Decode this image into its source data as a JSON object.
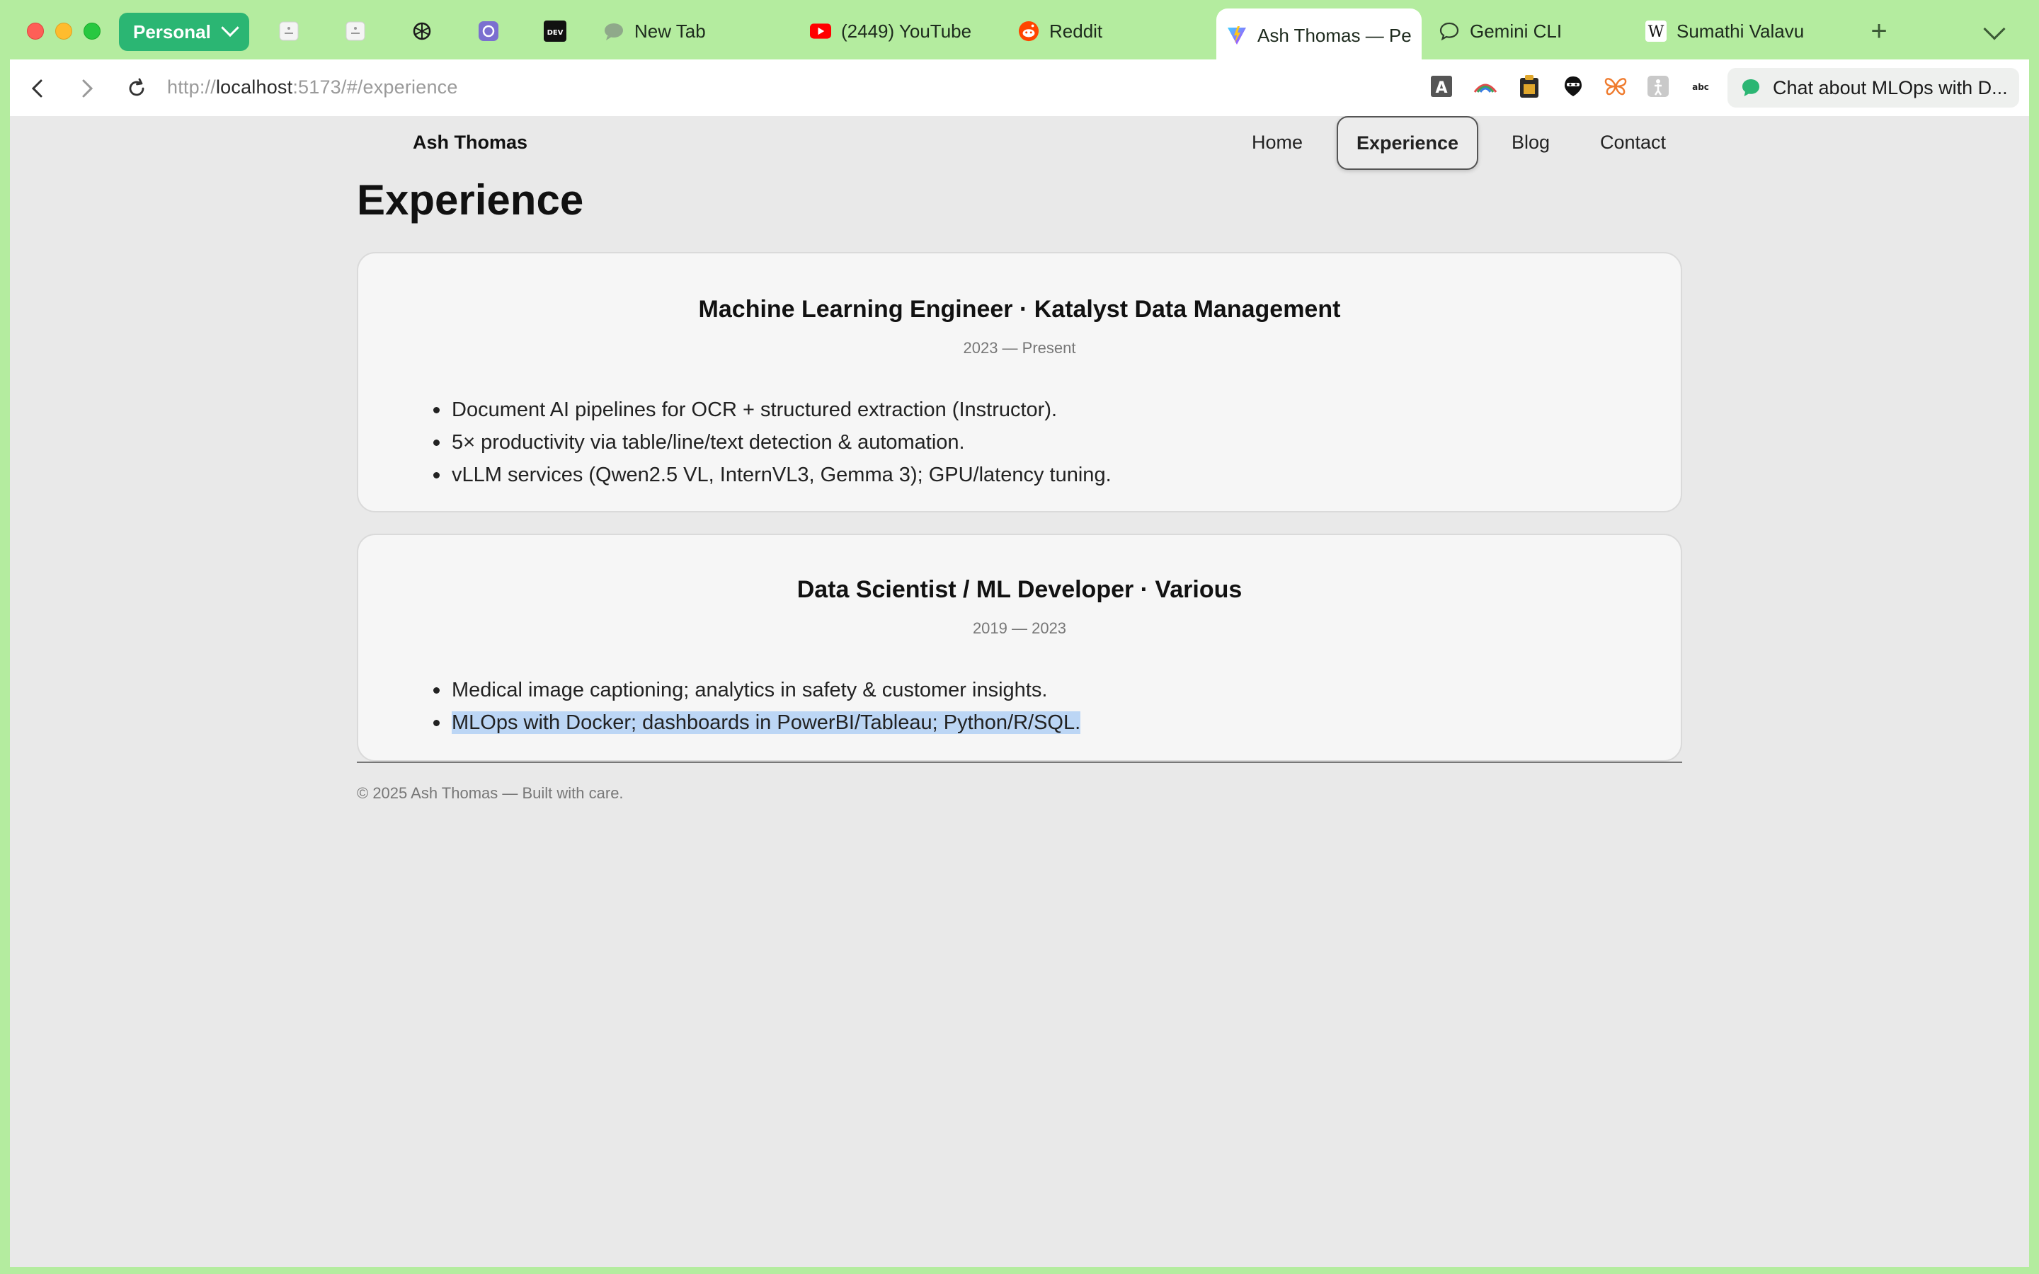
{
  "browser": {
    "profile_label": "Personal",
    "tabs": [
      {
        "label": "New Tab",
        "icon": "chat-bubble-icon"
      },
      {
        "label": "(2449) YouTube",
        "icon": "youtube-icon"
      },
      {
        "label": "Reddit",
        "icon": "reddit-icon"
      },
      {
        "label": "Ash Thomas — Pe",
        "icon": "vite-icon",
        "active": true
      },
      {
        "label": "Gemini CLI",
        "icon": "chat-outline-icon"
      },
      {
        "label": "Sumathi Valavu",
        "icon": "wikipedia-icon"
      }
    ],
    "url_scheme": "http://",
    "url_host": "localhost",
    "url_rest": ":5173/#/experience",
    "chat_pill_label": "Chat about MLOps with D...",
    "extension_icons": [
      "font-a-icon",
      "rainbow-icon",
      "clipboard-icon",
      "ninja-icon",
      "butterfly-icon",
      "figure-icon",
      "text-icon"
    ],
    "accent": "#2bb673",
    "frame_color": "#b4ec9f"
  },
  "site": {
    "brand": "Ash Thomas",
    "nav": [
      "Home",
      "Experience",
      "Blog",
      "Contact"
    ],
    "active_nav": "Experience",
    "page_title": "Experience",
    "experience": [
      {
        "role": "Machine Learning Engineer · Katalyst Data Management",
        "period": "2023 — Present",
        "bullets": [
          "Document AI pipelines for OCR + structured extraction (Instructor).",
          "5× productivity via table/line/text detection & automation.",
          "vLLM services (Qwen2.5 VL, InternVL3, Gemma 3); GPU/latency tuning."
        ]
      },
      {
        "role": "Data Scientist / ML Developer · Various",
        "period": "2019 — 2023",
        "bullets": [
          "Medical image captioning; analytics in safety & customer insights.",
          "MLOps with Docker; dashboards in PowerBI/Tableau; Python/R/SQL."
        ]
      }
    ],
    "footer": "© 2025 Ash Thomas — Built with care."
  }
}
